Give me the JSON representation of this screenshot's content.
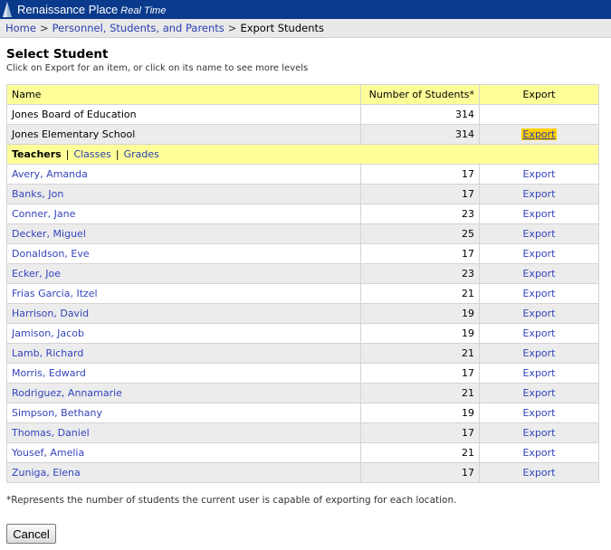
{
  "app": {
    "title": "Renaissance Place",
    "subtitle": "Real Time"
  },
  "breadcrumb": {
    "items": [
      "Home",
      "Personnel, Students, and Parents",
      "Export Students"
    ],
    "separator": ">"
  },
  "page": {
    "title": "Select Student",
    "instructions": "Click on Export for an item, or click on its name to see more levels"
  },
  "table": {
    "headers": {
      "name": "Name",
      "count": "Number of Students*",
      "export": "Export"
    },
    "district": {
      "name": "Jones Board of Education",
      "count": "314"
    },
    "school": {
      "name": "Jones Elementary School",
      "count": "314",
      "export": "Export"
    },
    "tabs": {
      "items": [
        "Teachers",
        "Classes",
        "Grades"
      ],
      "separator": "|",
      "active": "Teachers"
    },
    "teachers": [
      {
        "name": "Avery, Amanda",
        "count": "17",
        "export": "Export"
      },
      {
        "name": "Banks, Jon",
        "count": "17",
        "export": "Export"
      },
      {
        "name": "Conner, Jane",
        "count": "23",
        "export": "Export"
      },
      {
        "name": "Decker, Miguel",
        "count": "25",
        "export": "Export"
      },
      {
        "name": "Donaldson, Eve",
        "count": "17",
        "export": "Export"
      },
      {
        "name": "Ecker, Joe",
        "count": "23",
        "export": "Export"
      },
      {
        "name": "Frias Garcia, Itzel",
        "count": "21",
        "export": "Export"
      },
      {
        "name": "Harrison, David",
        "count": "19",
        "export": "Export"
      },
      {
        "name": "Jamison, Jacob",
        "count": "19",
        "export": "Export"
      },
      {
        "name": "Lamb, Richard",
        "count": "21",
        "export": "Export"
      },
      {
        "name": "Morris, Edward",
        "count": "17",
        "export": "Export"
      },
      {
        "name": "Rodriguez, Annamarie",
        "count": "21",
        "export": "Export"
      },
      {
        "name": "Simpson, Bethany",
        "count": "19",
        "export": "Export"
      },
      {
        "name": "Thomas, Daniel",
        "count": "17",
        "export": "Export"
      },
      {
        "name": "Yousef, Amelia",
        "count": "21",
        "export": "Export"
      },
      {
        "name": "Zuniga, Elena",
        "count": "17",
        "export": "Export"
      }
    ]
  },
  "footnote": "*Represents the number of students the current user is capable of exporting for each location.",
  "actions": {
    "cancel_label": "Cancel"
  },
  "colors": {
    "topbar": "#0a3a8c",
    "header_yellow": "#ffff99",
    "link": "#3344bb",
    "active_export_highlight": "#ffd000",
    "alt_row": "#ececec"
  },
  "icons": {
    "logo": "renaissance-logo-icon"
  }
}
